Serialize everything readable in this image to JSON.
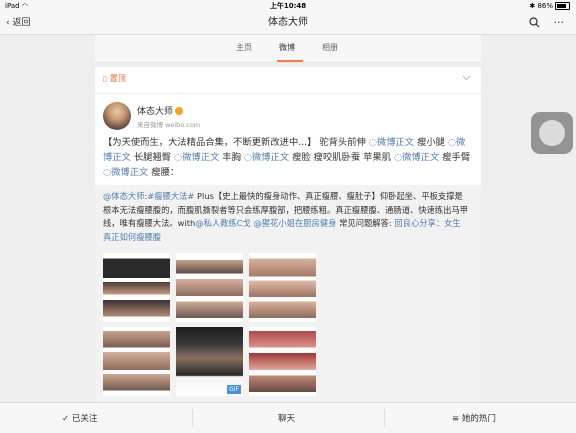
{
  "status_bar": {
    "device": "iPad",
    "time": "上午10:48",
    "battery": "86%"
  },
  "nav": {
    "back_label": "返回",
    "title": "体态大师",
    "more_icon": "···"
  },
  "tabs": [
    "主页",
    "微博",
    "相册"
  ],
  "active_tab": "微博",
  "post": {
    "pinned_label": "置顶",
    "author": "体态大师",
    "source": "来自微博 weibo.com",
    "text_parts": [
      {
        "t": "【为天使而生，大法精品合集，不断更新改进中...】 驼背头前伸 ",
        "link": false
      },
      {
        "t": "◌微博正文",
        "link": true
      },
      {
        "t": " 瘦小腿 ",
        "link": false
      },
      {
        "t": "◌微博正文",
        "link": true
      },
      {
        "t": " 长腿翘臀 ",
        "link": false
      },
      {
        "t": "◌微博正文",
        "link": true
      },
      {
        "t": " 丰胸 ",
        "link": false
      },
      {
        "t": "◌微博正文",
        "link": true
      },
      {
        "t": " 瘦脸 瘦咬肌卧蚕 苹果肌 ",
        "link": false
      },
      {
        "t": "◌微博正文",
        "link": true
      },
      {
        "t": " 瘦手臂 ",
        "link": false
      },
      {
        "t": "◌微博正文",
        "link": true
      },
      {
        "t": " 瘦腰：",
        "link": false
      }
    ],
    "repost_parts": [
      {
        "t": "@体态大师",
        "link": true
      },
      {
        "t": ":",
        "link": false
      },
      {
        "t": "#瘦腰大法#",
        "link": true
      },
      {
        "t": " Plus【史上最快的瘦身动作、真正瘦腰、瘦肚子】仰卧起坐、平板支撑是根本无法瘦腰腹的，而腹肌撕裂者等只会练厚腹部，把腰练粗。真正瘦腰腹、通肠道、快速练出马甲线，唯有瘦腰大法。with",
        "link": false
      },
      {
        "t": "@私人教练C戈",
        "link": true
      },
      {
        "t": " ",
        "link": false
      },
      {
        "t": "@猩花小姐在厨房健身",
        "link": true
      },
      {
        "t": " 常见问题解答: ",
        "link": false
      },
      {
        "t": "回良心分享：女生真正如何瘦腰腹",
        "link": true
      }
    ],
    "gif_badge": "GIF"
  },
  "bottom": {
    "follow": "已关注",
    "chat": "聊天",
    "her_hot": "她的热门"
  },
  "colors": {
    "accent": "#fa7d3c",
    "link": "#507daf",
    "pinned": "#e26c2e"
  }
}
